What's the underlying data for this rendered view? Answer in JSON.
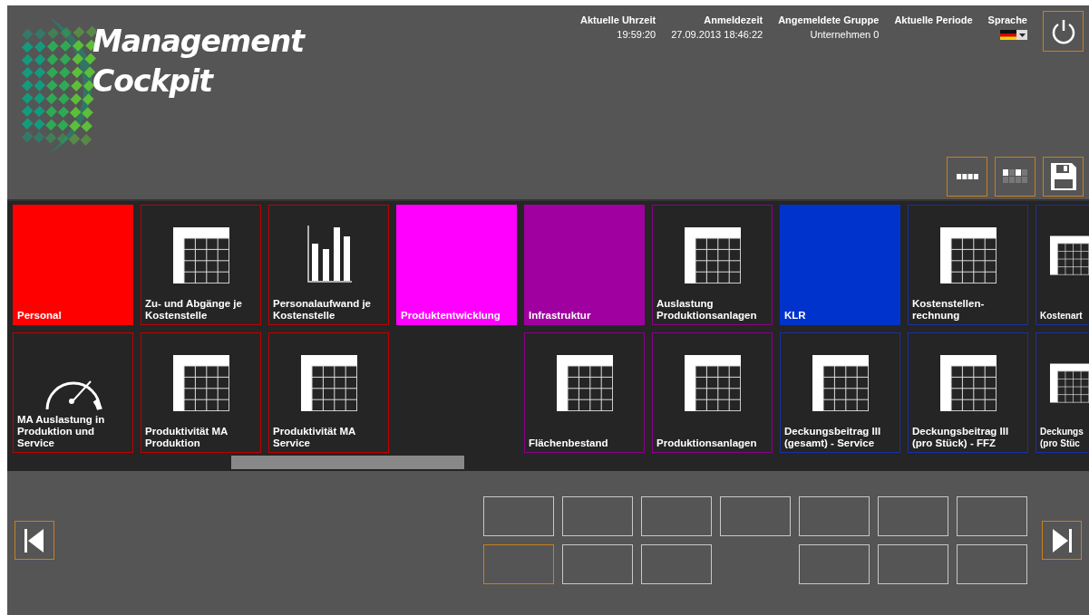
{
  "app": {
    "title_lines": [
      "Management",
      "Cockpit"
    ]
  },
  "info": [
    {
      "label": "Aktuelle Uhrzeit",
      "value": "19:59:20"
    },
    {
      "label": "Anmeldezeit",
      "value": "27.09.2013 18:46:22"
    },
    {
      "label": "Angemeldete Gruppe",
      "value": "Unternehmen 0"
    },
    {
      "label": "Aktuelle Periode"
    }
  ],
  "language": {
    "label": "Sprache"
  },
  "tile_rows": [
    [
      {
        "kind": "group",
        "label": "Personal",
        "color": "#ff0000"
      },
      {
        "kind": "table",
        "label": "Zu- und Abgänge je Kostenstelle",
        "color": "#c00000"
      },
      {
        "kind": "chart",
        "label": "Personalaufwand je Kostenstelle",
        "color": "#c00000"
      },
      {
        "kind": "group",
        "label": "Produktentwicklung",
        "color": "#ff00ff"
      },
      {
        "kind": "group",
        "label": "Infrastruktur",
        "color": "#a0009f"
      },
      {
        "kind": "table",
        "label": "Auslastung Produktionsanlagen",
        "color": "#8a008a"
      },
      {
        "kind": "group",
        "label": "KLR",
        "color": "#0033cc"
      },
      {
        "kind": "table",
        "label": "Kostenstellen-rechnung",
        "color": "#1a2fa0"
      },
      {
        "kind": "table",
        "label": "Kostenart",
        "color": "#1a2fa0"
      }
    ],
    [
      {
        "kind": "gauge",
        "label": "MA Auslastung in Produktion und Service",
        "color": "#c00000"
      },
      {
        "kind": "table",
        "label": "Produktivität MA Produktion",
        "color": "#c00000"
      },
      {
        "kind": "table",
        "label": "Produktivität MA Service",
        "color": "#c00000"
      },
      {
        "kind": "empty"
      },
      {
        "kind": "table",
        "label": "Flächenbestand",
        "color": "#8a008a"
      },
      {
        "kind": "table",
        "label": "Produktionsanlagen",
        "color": "#8a008a"
      },
      {
        "kind": "table",
        "label": "Deckungsbeitrag III (gesamt) - Service",
        "color": "#1a2fa0"
      },
      {
        "kind": "table",
        "label": "Deckungsbeitrag III (pro Stück) - FFZ",
        "color": "#1a2fa0"
      },
      {
        "kind": "table",
        "label": "Deckungs (pro Stüc",
        "color": "#1a2fa0"
      }
    ]
  ],
  "page_rows": [
    [
      {
        "kind": "page",
        "selected": false
      },
      {
        "kind": "page",
        "selected": false
      },
      {
        "kind": "page",
        "selected": false
      },
      {
        "kind": "page",
        "selected": false
      },
      {
        "kind": "page",
        "selected": false
      },
      {
        "kind": "page",
        "selected": false
      },
      {
        "kind": "page",
        "selected": false
      }
    ],
    [
      {
        "kind": "page",
        "selected": true
      },
      {
        "kind": "page",
        "selected": false
      },
      {
        "kind": "page",
        "selected": false
      },
      {
        "kind": "gap"
      },
      {
        "kind": "page",
        "selected": false
      },
      {
        "kind": "page",
        "selected": false
      },
      {
        "kind": "page",
        "selected": false
      }
    ]
  ]
}
